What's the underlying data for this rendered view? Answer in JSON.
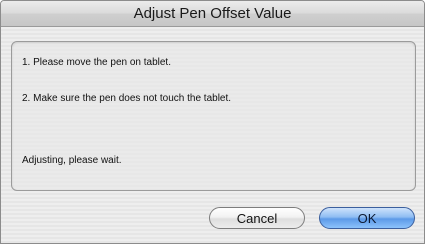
{
  "window": {
    "title": "Adjust Pen Offset Value"
  },
  "messages": {
    "step1": "1. Please move the pen on tablet.",
    "step2": "2. Make sure the pen does not touch the tablet.",
    "status": "Adjusting, please wait."
  },
  "buttons": {
    "cancel_label": "Cancel",
    "ok_label": "OK"
  }
}
